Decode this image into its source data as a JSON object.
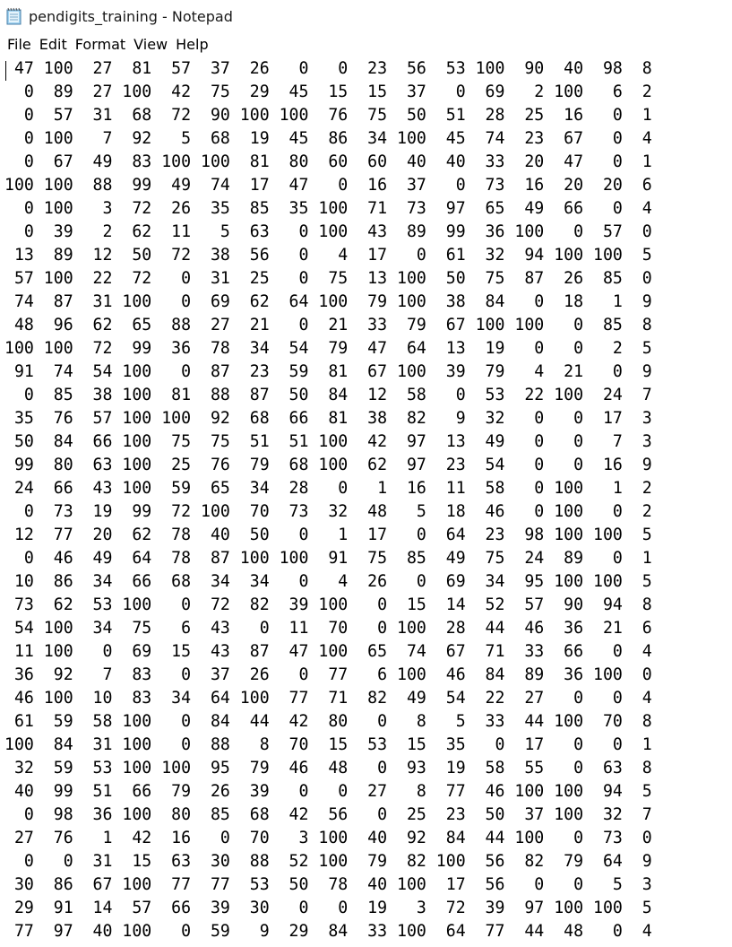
{
  "window": {
    "title": "pendigits_training - Notepad",
    "icon": "notepad-icon"
  },
  "menu": {
    "items": [
      "File",
      "Edit",
      "Format",
      "View",
      "Help"
    ]
  },
  "editor": {
    "lines": [
      " 47 100  27  81  57  37  26   0   0  23  56  53 100  90  40  98  8",
      "  0  89  27 100  42  75  29  45  15  15  37   0  69   2 100   6  2",
      "  0  57  31  68  72  90 100 100  76  75  50  51  28  25  16   0  1",
      "  0 100   7  92   5  68  19  45  86  34 100  45  74  23  67   0  4",
      "  0  67  49  83 100 100  81  80  60  60  40  40  33  20  47   0  1",
      "100 100  88  99  49  74  17  47   0  16  37   0  73  16  20  20  6",
      "  0 100   3  72  26  35  85  35 100  71  73  97  65  49  66   0  4",
      "  0  39   2  62  11   5  63   0 100  43  89  99  36 100   0  57  0",
      " 13  89  12  50  72  38  56   0   4  17   0  61  32  94 100 100  5",
      " 57 100  22  72   0  31  25   0  75  13 100  50  75  87  26  85  0",
      " 74  87  31 100   0  69  62  64 100  79 100  38  84   0  18   1  9",
      " 48  96  62  65  88  27  21   0  21  33  79  67 100 100   0  85  8",
      "100 100  72  99  36  78  34  54  79  47  64  13  19   0   0   2  5",
      " 91  74  54 100   0  87  23  59  81  67 100  39  79   4  21   0  9",
      "  0  85  38 100  81  88  87  50  84  12  58   0  53  22 100  24  7",
      " 35  76  57 100 100  92  68  66  81  38  82   9  32   0   0  17  3",
      " 50  84  66 100  75  75  51  51 100  42  97  13  49   0   0   7  3",
      " 99  80  63 100  25  76  79  68 100  62  97  23  54   0   0  16  9",
      " 24  66  43 100  59  65  34  28   0   1  16  11  58   0 100   1  2",
      "  0  73  19  99  72 100  70  73  32  48   5  18  46   0 100   0  2",
      " 12  77  20  62  78  40  50   0   1  17   0  64  23  98 100 100  5",
      "  0  46  49  64  78  87 100 100  91  75  85  49  75  24  89   0  1",
      " 10  86  34  66  68  34  34   0   4  26   0  69  34  95 100 100  5",
      " 73  62  53 100   0  72  82  39 100   0  15  14  52  57  90  94  8",
      " 54 100  34  75   6  43   0  11  70   0 100  28  44  46  36  21  6",
      " 11 100   0  69  15  43  87  47 100  65  74  67  71  33  66   0  4",
      " 36  92   7  83   0  37  26   0  77   6 100  46  84  89  36 100  0",
      " 46 100  10  83  34  64 100  77  71  82  49  54  22  27   0   0  4",
      " 61  59  58 100   0  84  44  42  80   0   8   5  33  44 100  70  8",
      "100  84  31 100   0  88   8  70  15  53  15  35   0  17   0   0  1",
      " 32  59  53 100 100  95  79  46  48   0  93  19  58  55   0  63  8",
      " 40  99  51  66  79  26  39   0   0  27   8  77  46 100 100  94  5",
      "  0  98  36 100  80  85  68  42  56   0  25  23  50  37 100  32  7",
      " 27  76   1  42  16   0  70   3 100  40  92  84  44 100   0  73  0",
      "  0   0  31  15  63  30  88  52 100  79  82 100  56  82  79  64  9",
      " 30  86  67 100  77  77  53  50  78  40 100  17  56   0   0   5  3",
      " 29  91  14  57  66  39  30   0   0  19   3  72  39  97 100 100  5",
      " 77  97  40 100   0  59   9  29  84  33 100  64  77  44  48   0  4"
    ]
  }
}
